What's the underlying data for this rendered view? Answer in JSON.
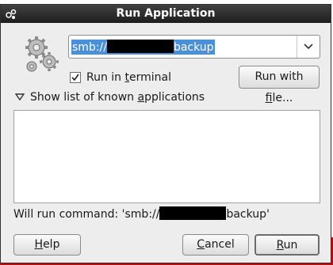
{
  "window": {
    "title": "Run Application"
  },
  "command": {
    "prefix": "smb://",
    "suffix": "backup"
  },
  "run_in_terminal": {
    "label_pre": "Run in ",
    "label_mnemonic": "t",
    "label_post": "erminal",
    "checked": true
  },
  "buttons": {
    "run_with_file": {
      "pre": "Run with ",
      "mnemonic": "f",
      "post": "ile..."
    },
    "help": {
      "pre": "",
      "mnemonic": "H",
      "post": "elp"
    },
    "cancel": {
      "pre": "",
      "mnemonic": "C",
      "post": "ancel"
    },
    "run": {
      "pre": "",
      "mnemonic": "R",
      "post": "un"
    }
  },
  "known_apps": {
    "label_pre": "Show list of known ",
    "label_mnemonic": "a",
    "label_post": "pplications",
    "expanded": false,
    "items": []
  },
  "status": {
    "prefix": "Will run command: 'smb://",
    "suffix": "backup'"
  },
  "colors": {
    "selection": "#4a90d9",
    "titlebar": "#2a2a2a"
  }
}
